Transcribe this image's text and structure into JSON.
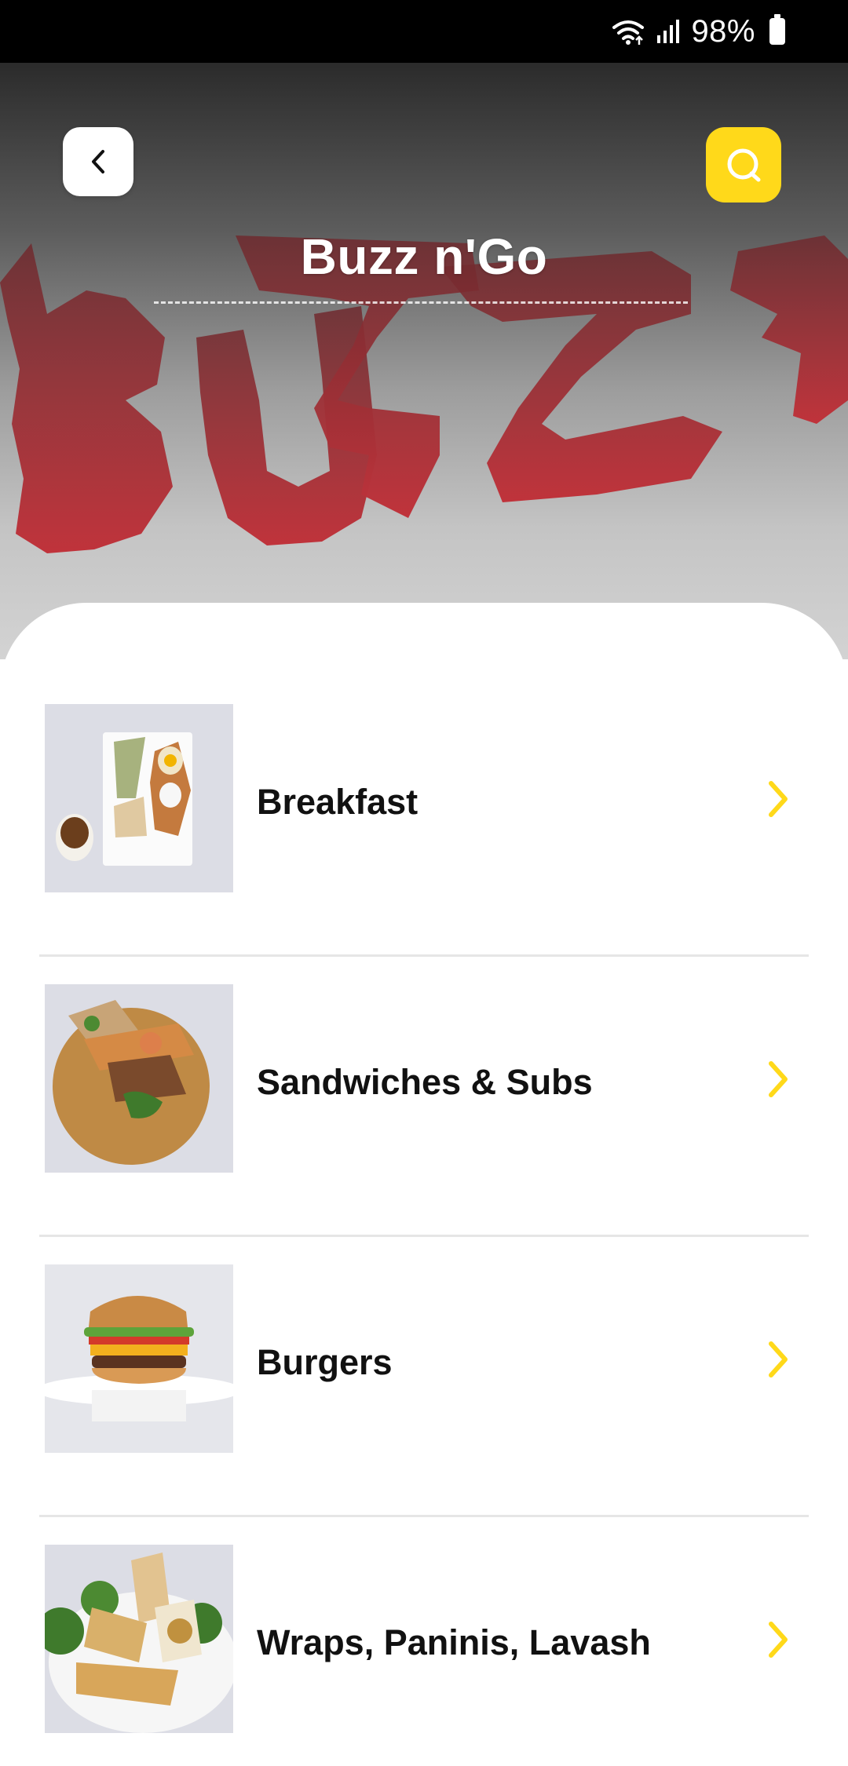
{
  "status_bar": {
    "battery_percent": "98%",
    "icons": [
      "wifi-icon",
      "signal-icon",
      "battery-icon"
    ]
  },
  "header": {
    "title": "Buzz n'Go",
    "back_icon": "chevron-left-icon",
    "search_icon": "search-icon",
    "logo_text": "BUZZ"
  },
  "colors": {
    "accent": "#ffd91a",
    "logo_red": "#c0333b",
    "text": "#111111"
  },
  "categories": [
    {
      "label": "Breakfast",
      "image": "breakfast-plate-photo"
    },
    {
      "label": "Sandwiches & Subs",
      "image": "sandwich-platter-photo"
    },
    {
      "label": "Burgers",
      "image": "burger-photo"
    },
    {
      "label": "Wraps, Paninis, Lavash",
      "image": "wraps-plate-photo"
    }
  ]
}
